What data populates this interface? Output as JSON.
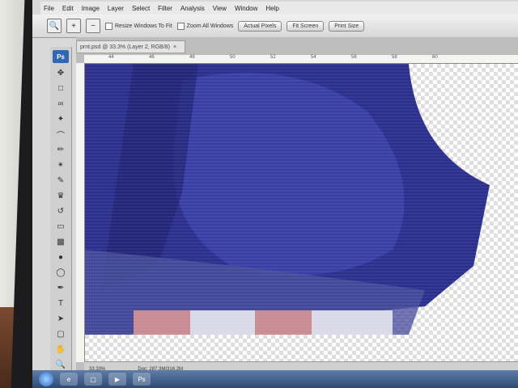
{
  "menu": [
    "File",
    "Edit",
    "Image",
    "Layer",
    "Select",
    "Filter",
    "Analysis",
    "View",
    "Window",
    "Help"
  ],
  "options": {
    "resize_windows": "Resize Windows To Fit",
    "zoom_all": "Zoom All Windows",
    "actual_pixels": "Actual Pixels",
    "fit_screen": "Fit Screen",
    "print_size": "Print Size"
  },
  "tools_logo": "Ps",
  "document": {
    "tab_title": "prnt.psd @ 33.3% (Layer 2, RGB/8)",
    "ruler_ticks": [
      "44",
      "46",
      "48",
      "50",
      "52",
      "54",
      "56",
      "58",
      "60"
    ],
    "zoom": "33.33%",
    "doc_size": "Doc: 287.3M/316.2M"
  },
  "taskbar": {
    "photoshop_label": "Ps"
  },
  "colors": {
    "fabric": "#2a2e8c",
    "fabric_light": "#3d45b0",
    "stripe_red": "#c98a92"
  }
}
